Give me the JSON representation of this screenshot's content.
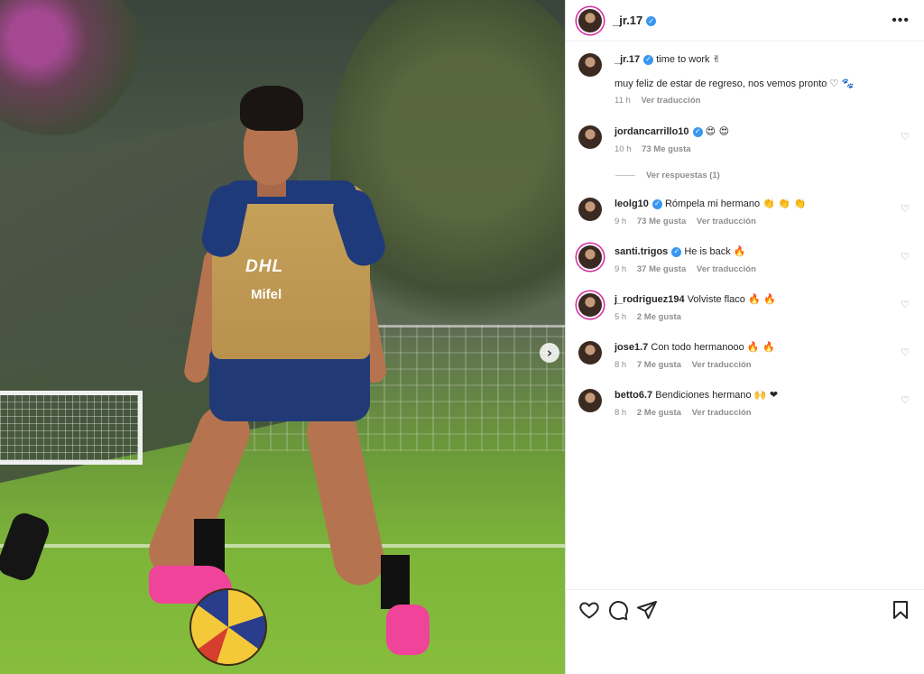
{
  "post": {
    "author": "_jr.17",
    "caption_title": "time to work",
    "caption_title_emoji": "✌",
    "caption_body": "muy feliz de estar de regreso, nos vemos pronto",
    "caption_body_emoji": "♡ 🐾",
    "caption_time": "11 h",
    "caption_translate": "Ver traducción",
    "photo": {
      "shirt_sponsor_1": "DHL",
      "shirt_sponsor_2": "Mifel"
    }
  },
  "comments": [
    {
      "user": "jordancarrillo10",
      "verified": true,
      "text": "",
      "emoji": "😍 😍",
      "time": "10 h",
      "likes": "73 Me gusta",
      "translate": "",
      "replies": "Ver respuestas (1)"
    },
    {
      "user": "leolg10",
      "verified": true,
      "text": "Rómpela mi hermano",
      "emoji": "👏 👏 👏",
      "time": "9 h",
      "likes": "73 Me gusta",
      "translate": "Ver traducción"
    },
    {
      "user": "santi.trigos",
      "verified": true,
      "text": "He is back",
      "emoji": "🔥",
      "time": "9 h",
      "likes": "37 Me gusta",
      "translate": "Ver traducción"
    },
    {
      "user": "j_rodriguez194",
      "verified": false,
      "text": "Volviste flaco",
      "emoji": "🔥 🔥",
      "time": "5 h",
      "likes": "2 Me gusta",
      "translate": ""
    },
    {
      "user": "jose1.7",
      "verified": false,
      "text": "Con todo hermanooo",
      "emoji": "🔥 🔥",
      "time": "8 h",
      "likes": "7 Me gusta",
      "translate": "Ver traducción"
    },
    {
      "user": "betto6.7",
      "verified": false,
      "text": "Bendiciones hermano",
      "emoji": "🙌 ❤",
      "time": "8 h",
      "likes": "2 Me gusta",
      "translate": "Ver traducción"
    }
  ],
  "icons": {
    "more": "more-horizontal-icon",
    "like": "heart-icon",
    "comment": "comment-bubble-icon",
    "share": "paper-plane-icon",
    "save": "bookmark-icon",
    "next": "chevron-right-icon"
  },
  "colors": {
    "verified": "#3897f0",
    "secondary_text": "#8e8e8e",
    "primary_text": "#262626"
  }
}
